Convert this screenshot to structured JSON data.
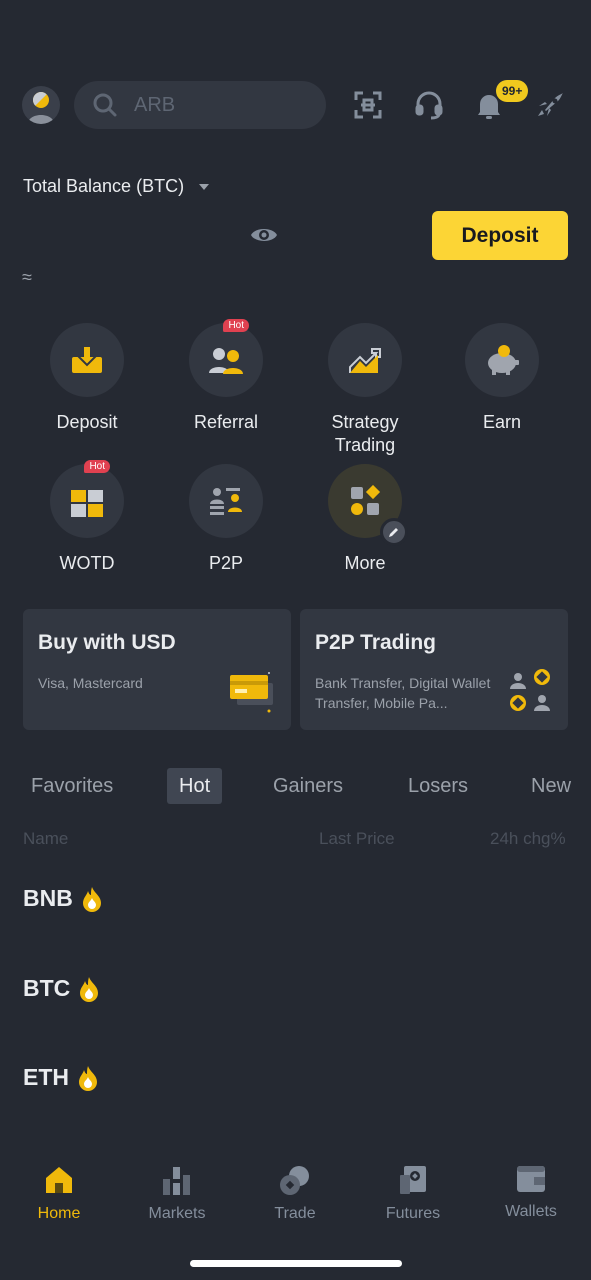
{
  "colors": {
    "background": "#252932",
    "accent": "#FCD535",
    "card": "#323741",
    "hot": "#E04150"
  },
  "header": {
    "search_placeholder": "ARB",
    "icons": [
      "avatar",
      "search-icon",
      "scan-icon",
      "headset-icon",
      "bell-icon",
      "rocket-icon"
    ],
    "notification_badge": "99+"
  },
  "balance": {
    "label": "Total Balance (BTC)",
    "deposit_label": "Deposit",
    "approx_symbol": "≈"
  },
  "shortcuts": [
    {
      "label": "Deposit",
      "icon": "deposit-icon"
    },
    {
      "label": "Referral",
      "icon": "referral-icon",
      "tag": "Hot"
    },
    {
      "label": "Strategy Trading",
      "icon": "chart-icon"
    },
    {
      "label": "Earn",
      "icon": "piggy-bank-icon"
    },
    {
      "label": "WOTD",
      "icon": "puzzle-icon",
      "tag": "Hot"
    },
    {
      "label": "P2P",
      "icon": "p2p-icon"
    },
    {
      "label": "More",
      "icon": "more-icon"
    }
  ],
  "cards": [
    {
      "title": "Buy with USD",
      "subtitle": "Visa, Mastercard"
    },
    {
      "title": "P2P Trading",
      "subtitle": "Bank Transfer, Digital Wallet Transfer, Mobile Pa..."
    }
  ],
  "market_tabs": [
    "Favorites",
    "Hot",
    "Gainers",
    "Losers",
    "New"
  ],
  "active_tab": "Hot",
  "columns": {
    "name": "Name",
    "last_price": "Last Price",
    "change": "24h chg%"
  },
  "coins": [
    "BNB",
    "BTC",
    "ETH"
  ],
  "nav": [
    {
      "label": "Home",
      "active": true
    },
    {
      "label": "Markets"
    },
    {
      "label": "Trade"
    },
    {
      "label": "Futures"
    },
    {
      "label": "Wallets"
    }
  ]
}
